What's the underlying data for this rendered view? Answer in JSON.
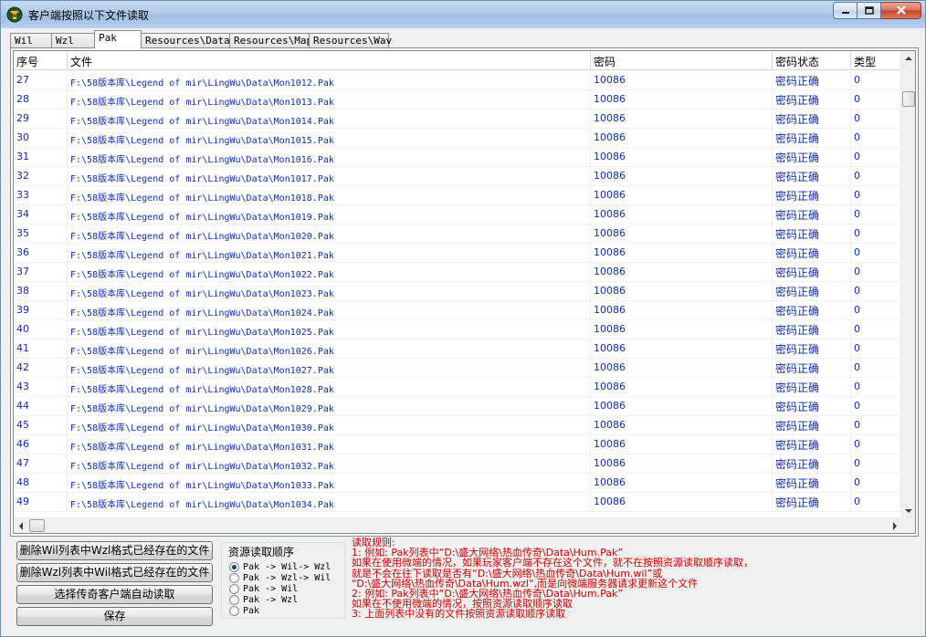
{
  "window": {
    "title": "客户端按照以下文件读取"
  },
  "tabs": [
    {
      "label": "Wil",
      "active": false
    },
    {
      "label": "Wzl",
      "active": false
    },
    {
      "label": "Pak",
      "active": true
    },
    {
      "label": "Resources\\Data",
      "active": false
    },
    {
      "label": "Resources\\Map",
      "active": false
    },
    {
      "label": "Resources\\Wav",
      "active": false
    }
  ],
  "list": {
    "columns": [
      "序号",
      "文件",
      "密码",
      "密码状态",
      "类型"
    ],
    "rows": [
      [
        "27",
        "F:\\58版本库\\Legend of mir\\LingWu\\Data\\Mon1012.Pak",
        "10086",
        "密码正确",
        "0"
      ],
      [
        "28",
        "F:\\58版本库\\Legend of mir\\LingWu\\Data\\Mon1013.Pak",
        "10086",
        "密码正确",
        "0"
      ],
      [
        "29",
        "F:\\58版本库\\Legend of mir\\LingWu\\Data\\Mon1014.Pak",
        "10086",
        "密码正确",
        "0"
      ],
      [
        "30",
        "F:\\58版本库\\Legend of mir\\LingWu\\Data\\Mon1015.Pak",
        "10086",
        "密码正确",
        "0"
      ],
      [
        "31",
        "F:\\58版本库\\Legend of mir\\LingWu\\Data\\Mon1016.Pak",
        "10086",
        "密码正确",
        "0"
      ],
      [
        "32",
        "F:\\58版本库\\Legend of mir\\LingWu\\Data\\Mon1017.Pak",
        "10086",
        "密码正确",
        "0"
      ],
      [
        "33",
        "F:\\58版本库\\Legend of mir\\LingWu\\Data\\Mon1018.Pak",
        "10086",
        "密码正确",
        "0"
      ],
      [
        "34",
        "F:\\58版本库\\Legend of mir\\LingWu\\Data\\Mon1019.Pak",
        "10086",
        "密码正确",
        "0"
      ],
      [
        "35",
        "F:\\58版本库\\Legend of mir\\LingWu\\Data\\Mon1020.Pak",
        "10086",
        "密码正确",
        "0"
      ],
      [
        "36",
        "F:\\58版本库\\Legend of mir\\LingWu\\Data\\Mon1021.Pak",
        "10086",
        "密码正确",
        "0"
      ],
      [
        "37",
        "F:\\58版本库\\Legend of mir\\LingWu\\Data\\Mon1022.Pak",
        "10086",
        "密码正确",
        "0"
      ],
      [
        "38",
        "F:\\58版本库\\Legend of mir\\LingWu\\Data\\Mon1023.Pak",
        "10086",
        "密码正确",
        "0"
      ],
      [
        "39",
        "F:\\58版本库\\Legend of mir\\LingWu\\Data\\Mon1024.Pak",
        "10086",
        "密码正确",
        "0"
      ],
      [
        "40",
        "F:\\58版本库\\Legend of mir\\LingWu\\Data\\Mon1025.Pak",
        "10086",
        "密码正确",
        "0"
      ],
      [
        "41",
        "F:\\58版本库\\Legend of mir\\LingWu\\Data\\Mon1026.Pak",
        "10086",
        "密码正确",
        "0"
      ],
      [
        "42",
        "F:\\58版本库\\Legend of mir\\LingWu\\Data\\Mon1027.Pak",
        "10086",
        "密码正确",
        "0"
      ],
      [
        "43",
        "F:\\58版本库\\Legend of mir\\LingWu\\Data\\Mon1028.Pak",
        "10086",
        "密码正确",
        "0"
      ],
      [
        "44",
        "F:\\58版本库\\Legend of mir\\LingWu\\Data\\Mon1029.Pak",
        "10086",
        "密码正确",
        "0"
      ],
      [
        "45",
        "F:\\58版本库\\Legend of mir\\LingWu\\Data\\Mon1030.Pak",
        "10086",
        "密码正确",
        "0"
      ],
      [
        "46",
        "F:\\58版本库\\Legend of mir\\LingWu\\Data\\Mon1031.Pak",
        "10086",
        "密码正确",
        "0"
      ],
      [
        "47",
        "F:\\58版本库\\Legend of mir\\LingWu\\Data\\Mon1032.Pak",
        "10086",
        "密码正确",
        "0"
      ],
      [
        "48",
        "F:\\58版本库\\Legend of mir\\LingWu\\Data\\Mon1033.Pak",
        "10086",
        "密码正确",
        "0"
      ],
      [
        "49",
        "F:\\58版本库\\Legend of mir\\LingWu\\Data\\Mon1034.Pak",
        "10086",
        "密码正确",
        "0"
      ]
    ]
  },
  "buttons": {
    "delete_wil": "删除Wil列表中Wzl格式已经存在的文件",
    "delete_wzl": "删除Wzl列表中Wil格式已经存在的文件",
    "select_client": "选择传奇客户端自动读取",
    "save": "保存"
  },
  "read_order": {
    "title": "资源读取顺序",
    "options": [
      {
        "label": "Pak -> Wil-> Wzl",
        "selected": true
      },
      {
        "label": "Pak -> Wzl-> Wil",
        "selected": false
      },
      {
        "label": "Pak -> Wil",
        "selected": false
      },
      {
        "label": "Pak -> Wzl",
        "selected": false
      },
      {
        "label": "Pak",
        "selected": false
      }
    ]
  },
  "rules": [
    "读取规则:",
    "1: 例如: Pak列表中“D:\\盛大网络\\热血传奇\\Data\\Hum.Pak”",
    "     如果在使用微端的情况，如果玩家客户端不存在这个文件，就不在按照资源读取顺序读取，",
    "     就是不会在往下读取是否有“D:\\盛大网络\\热血传奇\\Data\\Hum.wil”或",
    "   “D:\\盛大网络\\热血传奇\\Data\\Hum.wzl”,而是向微端服务器请求更新这个文件",
    "2: 例如: Pak列表中“D:\\盛大网络\\热血传奇\\Data\\Hum.Pak”",
    "     如果在不使用微端的情况，按照资源读取顺序读取",
    "3: 上面列表中没有的文件按照资源读取顺序读取"
  ],
  "colors": {
    "list_text": "#0f2fa8",
    "rules_text": "#d00000"
  },
  "icons": {
    "app": "app-logo-icon",
    "minimize": "minimize-icon",
    "maximize": "maximize-icon",
    "close": "close-icon"
  }
}
